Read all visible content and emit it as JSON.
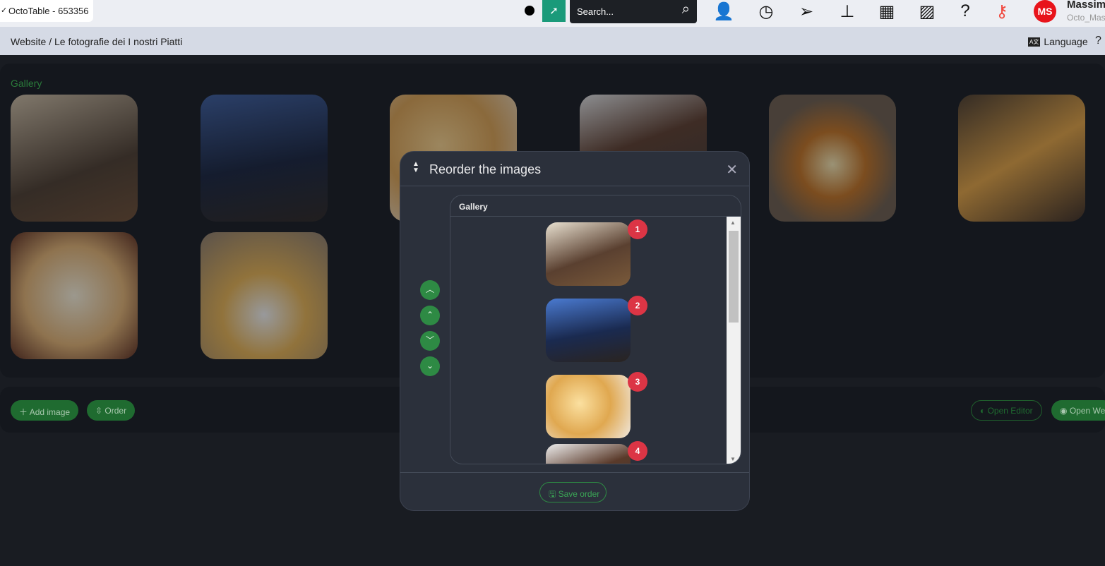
{
  "topbar": {
    "tab_label": "OctoTable - 653356",
    "search_placeholder": "Search...",
    "user_initials": "MS",
    "user_name": "Massim",
    "user_sub": "Octo_Mas",
    "help": "?"
  },
  "breadcrumb": "Website / Le fotografie dei I nostri Piatti",
  "language_label": "Language",
  "help_label": "?",
  "gallery": {
    "title": "Gallery",
    "images": [
      "Restaurant interior",
      "Eiffel Tower terrace",
      "Tortellini pasta",
      "Chocolate cake",
      "Arancino",
      "French fries",
      "Pizza Margherita",
      "Cake with powdered sugar"
    ]
  },
  "actions": {
    "add_image": "Add image",
    "order": "Order",
    "open_editor": "Open Editor",
    "open_website": "Open We"
  },
  "modal": {
    "title": "Reorder the images",
    "panel_title": "Gallery",
    "save_label": "Save order",
    "items": [
      {
        "num": "1"
      },
      {
        "num": "2"
      },
      {
        "num": "3"
      },
      {
        "num": "4"
      }
    ]
  },
  "colors": {
    "accent": "#2e8a44",
    "badge": "#dc3545",
    "avatar": "#e8141b"
  }
}
